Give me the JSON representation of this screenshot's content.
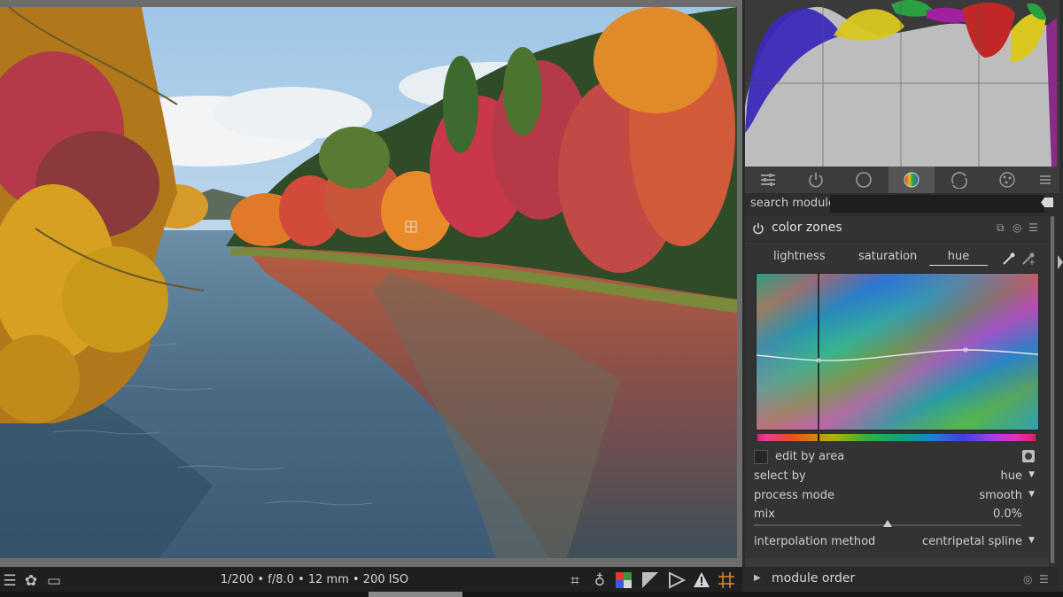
{
  "bottom_bar": {
    "exif": "1/200 • f/8.0 • 12 mm • 200 ISO",
    "left_icons": [
      "hamburger-icon",
      "styles-icon",
      "second-window-icon"
    ],
    "right_icons": [
      "focus-peaking-icon",
      "lightbulb-icon",
      "color-assessment-icon",
      "softproof-icon",
      "gamut-check-icon",
      "overexposed-warning-icon",
      "guides-icon"
    ]
  },
  "module_tabs": [
    "presets-icon",
    "active-modules-icon",
    "base-modules-icon",
    "color-modules-icon",
    "correct-modules-icon",
    "effect-modules-icon",
    "more-icon"
  ],
  "search": {
    "label": "search module",
    "placeholder": ""
  },
  "module": {
    "title": "color zones",
    "subtabs": [
      "lightness",
      "saturation",
      "hue"
    ],
    "active_subtab": "hue",
    "edit_by_area_label": "edit by area",
    "select_by": {
      "label": "select by",
      "value": "hue"
    },
    "process_mode": {
      "label": "process mode",
      "value": "smooth"
    },
    "mix": {
      "label": "mix",
      "value": "0.0%",
      "level": 0.5
    },
    "interpolation": {
      "label": "interpolation method",
      "value": "centripetal spline"
    }
  },
  "module_order": {
    "label": "module order"
  },
  "colors": {
    "accent": "#e0e0e0",
    "panel_bg": "#2e2e2e",
    "image_border": "#6d6d6d"
  }
}
